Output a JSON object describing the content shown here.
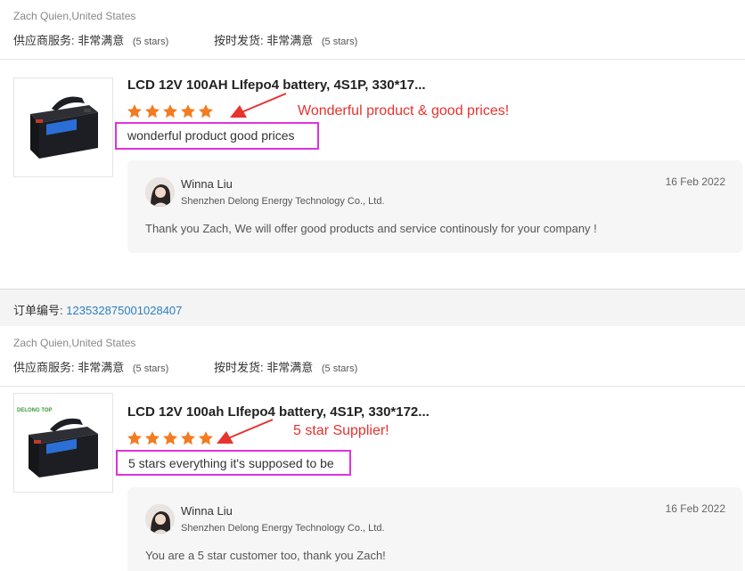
{
  "top_section": {
    "buyer": "Zach Quien,United States",
    "service_label": "供应商服务:",
    "service_value": "非常满意",
    "service_stars": "(5 stars)",
    "delivery_label": "按时发货:",
    "delivery_value": "非常满意",
    "delivery_stars": "(5 stars)"
  },
  "reviews": [
    {
      "product_title": "LCD 12V 100AH LIfepo4 battery, 4S1P, 330*17...",
      "rating": 5,
      "annotation": "Wonderful product & good prices!",
      "review_text": "wonderful product good prices",
      "reply": {
        "name": "Winna Liu",
        "company": "Shenzhen Delong Energy Technology Co., Ltd.",
        "date": "16 Feb 2022",
        "text": "Thank you Zach, We will offer good products and service continously for your company !"
      }
    },
    {
      "product_title": "LCD 12V 100ah LIfepo4 battery, 4S1P, 330*172...",
      "rating": 5,
      "annotation": "5 star Supplier!",
      "review_text": "5 stars everything it's supposed to be",
      "reply": {
        "name": "Winna Liu",
        "company": "Shenzhen Delong Energy Technology Co., Ltd.",
        "date": "16 Feb 2022",
        "text": "You are a 5 star customer too, thank you Zach!"
      }
    }
  ],
  "order": {
    "label": "订单编号:",
    "number": "123532875001028407"
  },
  "second_section": {
    "buyer": "Zach Quien,United States",
    "service_label": "供应商服务:",
    "service_value": "非常满意",
    "service_stars": "(5 stars)",
    "delivery_label": "按时发货:",
    "delivery_value": "非常满意",
    "delivery_stars": "(5 stars)"
  },
  "thumb_brand": "DELONG TOP",
  "colors": {
    "star": "#f47b20",
    "annotation": "#e8322e",
    "highlight_box": "#dd33dd",
    "order_link": "#2a7fc1"
  }
}
